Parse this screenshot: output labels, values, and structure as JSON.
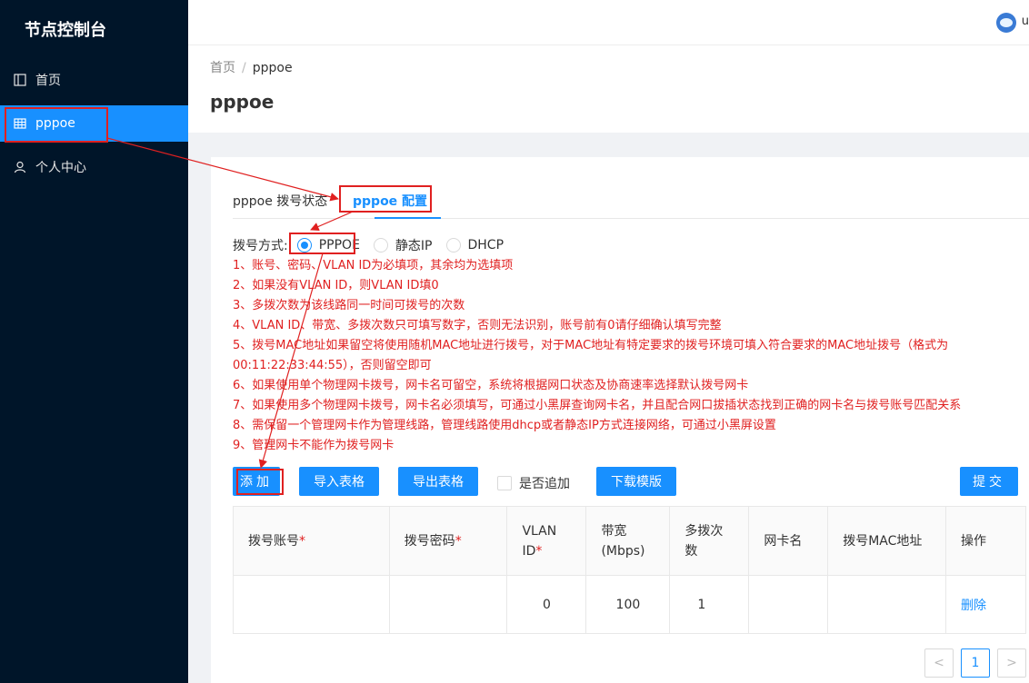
{
  "sidebar": {
    "brand": "节点控制台",
    "items": [
      {
        "label": "首页",
        "icon": "layout-icon"
      },
      {
        "label": "pppoe",
        "icon": "table-icon"
      },
      {
        "label": "个人中心",
        "icon": "user-icon"
      }
    ]
  },
  "topbar": {
    "user_initial": "u"
  },
  "breadcrumb": {
    "home": "首页",
    "sep": "/",
    "current": "pppoe"
  },
  "page_title": "pppoe",
  "tabs": [
    "pppoe 拨号状态",
    "pppoe 配置"
  ],
  "dial": {
    "label": "拨号方式:",
    "options": [
      "PPPOE",
      "静态IP",
      "DHCP"
    ],
    "selected": "PPPOE"
  },
  "notes": [
    "1、账号、密码、VLAN ID为必填项，其余均为选填项",
    "2、如果没有VLAN ID，则VLAN ID填0",
    "3、多拨次数为该线路同一时间可拨号的次数",
    "4、VLAN ID、带宽、多拨次数只可填写数字，否则无法识别，账号前有0请仔细确认填写完整",
    "5、拨号MAC地址如果留空将使用随机MAC地址进行拨号，对于MAC地址有特定要求的拨号环境可填入符合要求的MAC地址拨号（格式为",
    "00:11:22:33:44:55），否则留空即可",
    "6、如果使用单个物理网卡拨号，网卡名可留空，系统将根据网口状态及协商速率选择默认拨号网卡",
    "7、如果使用多个物理网卡拨号，网卡名必须填写，可通过小黑屏查询网卡名，并且配合网口拔插状态找到正确的网卡名与拨号账号匹配关系",
    "8、需保留一个管理网卡作为管理线路，管理线路使用dhcp或者静态IP方式连接网络，可通过小黑屏设置",
    "9、管理网卡不能作为拨号网卡"
  ],
  "toolbar": {
    "add": "添加",
    "import": "导入表格",
    "export": "导出表格",
    "append": "是否追加",
    "template": "下载模版",
    "submit": "提交"
  },
  "table": {
    "headers": {
      "account": "拨号账号",
      "password": "拨号密码",
      "vlan_a": "VLAN",
      "vlan_b": "ID",
      "bw_a": "带宽",
      "bw_b": "(Mbps)",
      "multi_a": "多拨次",
      "multi_b": "数",
      "nic": "网卡名",
      "mac": "拨号MAC地址",
      "action": "操作",
      "required_mark": "*"
    },
    "rows": [
      {
        "account": "",
        "password": "",
        "vlan": "0",
        "bandwidth": "100",
        "multi": "1",
        "nic": "",
        "mac": "",
        "action": "删除"
      }
    ]
  },
  "pagination": {
    "prev": "<",
    "current": "1",
    "next": ">"
  },
  "colors": {
    "primary": "#1890ff",
    "sidebar": "#001529",
    "annotation": "#e02020"
  }
}
